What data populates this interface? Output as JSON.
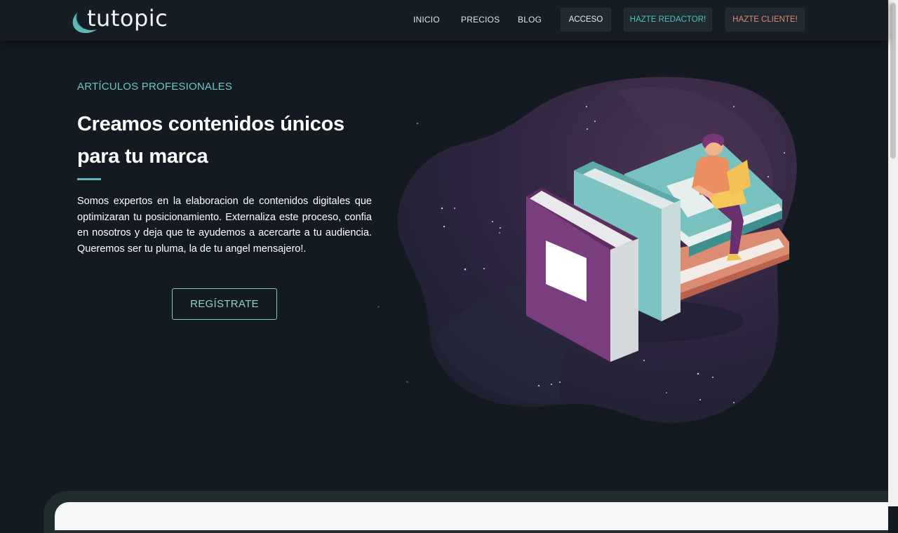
{
  "brand": {
    "name": "tutopic",
    "logo_icon": "feather-swoosh-icon",
    "accent": "#5fb7b7"
  },
  "nav": {
    "links": [
      "INICIO",
      "PRECIOS",
      "BLOG"
    ],
    "login": "ACCESO",
    "writer_cta": "HAZTE REDACTOR!",
    "client_cta": "HAZTE CLIENTE!",
    "writer_color": "#4fc1bd",
    "client_color": "#e0876c"
  },
  "hero": {
    "kicker": "ARTÍCULOS PROFESIONALES",
    "headline": "Creamos contenidos únicos para tu marca",
    "body": "Somos expertos en la elaboracion de contenidos digitales que optimizaran tu posicionamiento. Externaliza este proceso, confia en nosotros y deja que te ayudemos a acercarte a tu audiencia. Queremos ser tu pluma, la de tu angel mensajero!.",
    "cta": "REGÍSTRATE",
    "illustration": "person-reading-on-books-illustration"
  }
}
